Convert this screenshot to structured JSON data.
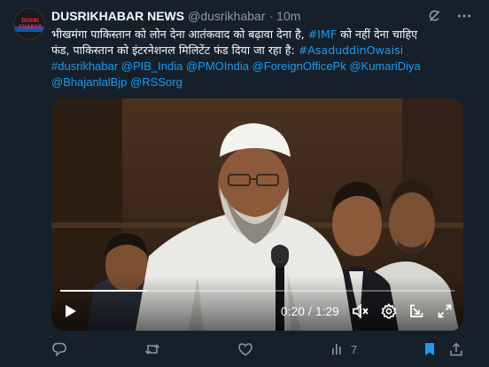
{
  "tweet": {
    "avatar_icon": "dusrikhabar-logo-icon",
    "avatar_logo_text": "DUSRI KHABAR",
    "name": "DUSRIKHABAR NEWS",
    "handle": "@dusrikhabar",
    "separator": "·",
    "time": "10m",
    "lines": [
      {
        "plain": "भीखमंगा पाकिस्तान को लोन देना आतंकवाद को बढ़ावा देना है, ",
        "link": "#IMF",
        "tail": " को नहीं देना चाहिए"
      },
      {
        "plain": "फंड,  पाकिस्तान को इंटरनेशनल मिलिटेंट फंड दिया जा रहा है: ",
        "link": "#AsaduddinOwaisi",
        "tail": ""
      },
      {
        "plain": "",
        "link": "#dusrikhabar @PIB_India @PMOIndia @ForeignOfficePk @KumariDiya",
        "tail": ""
      },
      {
        "plain": "",
        "link": "@BhajanlalBjp @RSSorg",
        "tail": ""
      }
    ],
    "top_icons": [
      "grok-icon",
      "more-icon"
    ]
  },
  "video": {
    "elapsed": "0:20",
    "separator": " / ",
    "duration": "1:29",
    "progress_fraction": 0.22,
    "icons": [
      "play-icon",
      "mute-icon",
      "settings-icon",
      "popout-icon",
      "fullscreen-icon"
    ]
  },
  "actions": {
    "reply_icon": "reply-icon",
    "retweet_icon": "retweet-icon",
    "like_icon": "like-icon",
    "views_icon": "views-icon",
    "views_count": "7",
    "bookmark_icon": "bookmark-icon",
    "share_icon": "share-icon"
  },
  "colors": {
    "background": "#15202b",
    "link": "#1d9bf0",
    "muted": "#8b98a5",
    "bookmark_active": "#1d9bf0"
  }
}
